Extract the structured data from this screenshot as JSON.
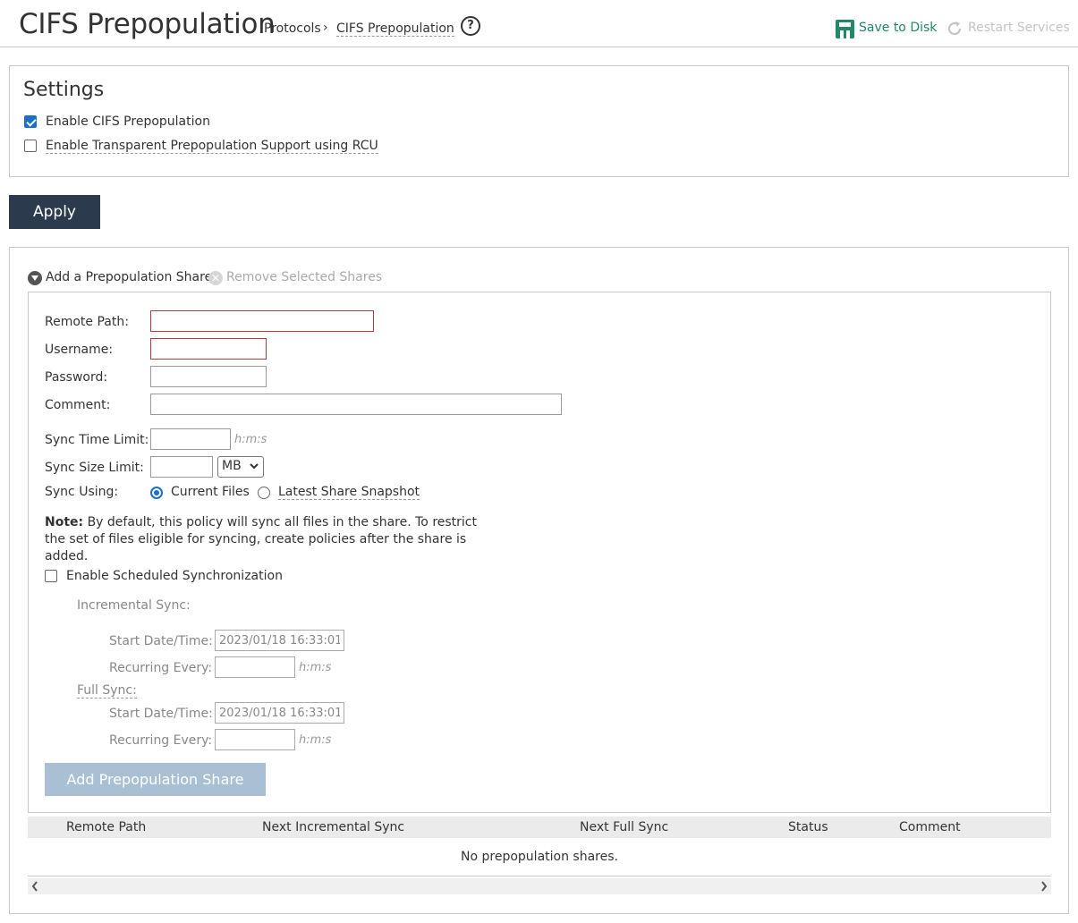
{
  "header": {
    "title": "CIFS Prepopulation",
    "breadcrumb": [
      "Protocols",
      "CIFS Prepopulation"
    ],
    "breadcrumb_sep": "›",
    "help_glyph": "?",
    "save_label": "Save to Disk",
    "restart_label": "Restart Services",
    "accent_color": "#24876c"
  },
  "settings": {
    "title": "Settings",
    "enable_cifs_label": "Enable CIFS Prepopulation",
    "enable_cifs_checked": true,
    "enable_rcu_label": "Enable Transparent Prepopulation Support using RCU",
    "enable_rcu_checked": false,
    "apply_label": "Apply"
  },
  "shares": {
    "add_toggle_label": "Add a Prepopulation Share",
    "remove_label": "Remove Selected Shares",
    "form": {
      "remote_path_label": "Remote Path:",
      "username_label": "Username:",
      "password_label": "Password:",
      "comment_label": "Comment:",
      "sync_time_label": "Sync Time Limit:",
      "sync_time_unit": "h:m:s",
      "sync_size_label": "Sync Size Limit:",
      "sync_size_unit": "MB",
      "sync_using_label": "Sync Using:",
      "sync_option_current": "Current Files",
      "sync_option_snapshot": "Latest Share Snapshot",
      "note_prefix": "Note:",
      "note_text": " By default, this policy will sync all files in the share. To restrict the set of files eligible for syncing, create policies after the share is added.",
      "scheduled_label": "Enable Scheduled Synchronization",
      "incremental_label": "Incremental Sync:",
      "full_label": "Full Sync:",
      "start_label": "Start Date/Time:",
      "recurring_label": "Recurring Every:",
      "incremental_start_value": "2023/01/18 16:33:01",
      "full_start_value": "2023/01/18 16:33:01",
      "recurring_unit": "h:m:s",
      "add_button_label": "Add Prepopulation Share"
    },
    "table": {
      "columns": [
        "Remote Path",
        "Next Incremental Sync",
        "Next Full Sync",
        "Status",
        "Comment"
      ],
      "empty_message": "No prepopulation shares."
    }
  }
}
